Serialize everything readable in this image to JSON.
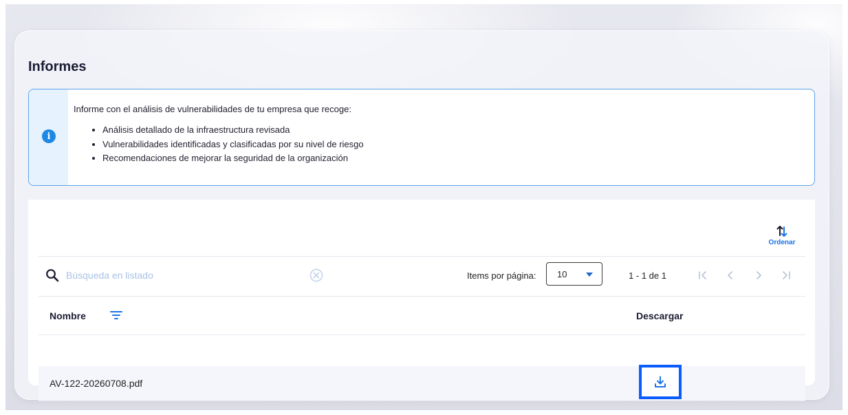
{
  "page": {
    "title": "Informes"
  },
  "info": {
    "intro": "Informe con el análisis de vulnerabilidades de tu empresa que recoge:",
    "items": [
      "Análisis detallado de la infraestructura revisada",
      "Vulnerabilidades identificadas y clasificadas por su nivel de riesgo",
      "Recomendaciones de mejorar la seguridad de la organización"
    ],
    "icon": "info-icon"
  },
  "toolbar": {
    "sort_label": "Ordenar",
    "sort_icon": "sort-arrows-icon"
  },
  "search": {
    "placeholder": "Búsqueda en listado",
    "value": ""
  },
  "pagination": {
    "items_per_page_label": "Items por página:",
    "items_per_page_value": "10",
    "range": "1 - 1 de 1"
  },
  "table": {
    "columns": {
      "name": "Nombre",
      "download": "Descargar"
    },
    "rows": [
      {
        "name": "AV-122-20260708.pdf"
      }
    ]
  },
  "colors": {
    "accent": "#1a73e8",
    "info_border": "#5aa3e8",
    "highlight": "#0b5cff"
  }
}
